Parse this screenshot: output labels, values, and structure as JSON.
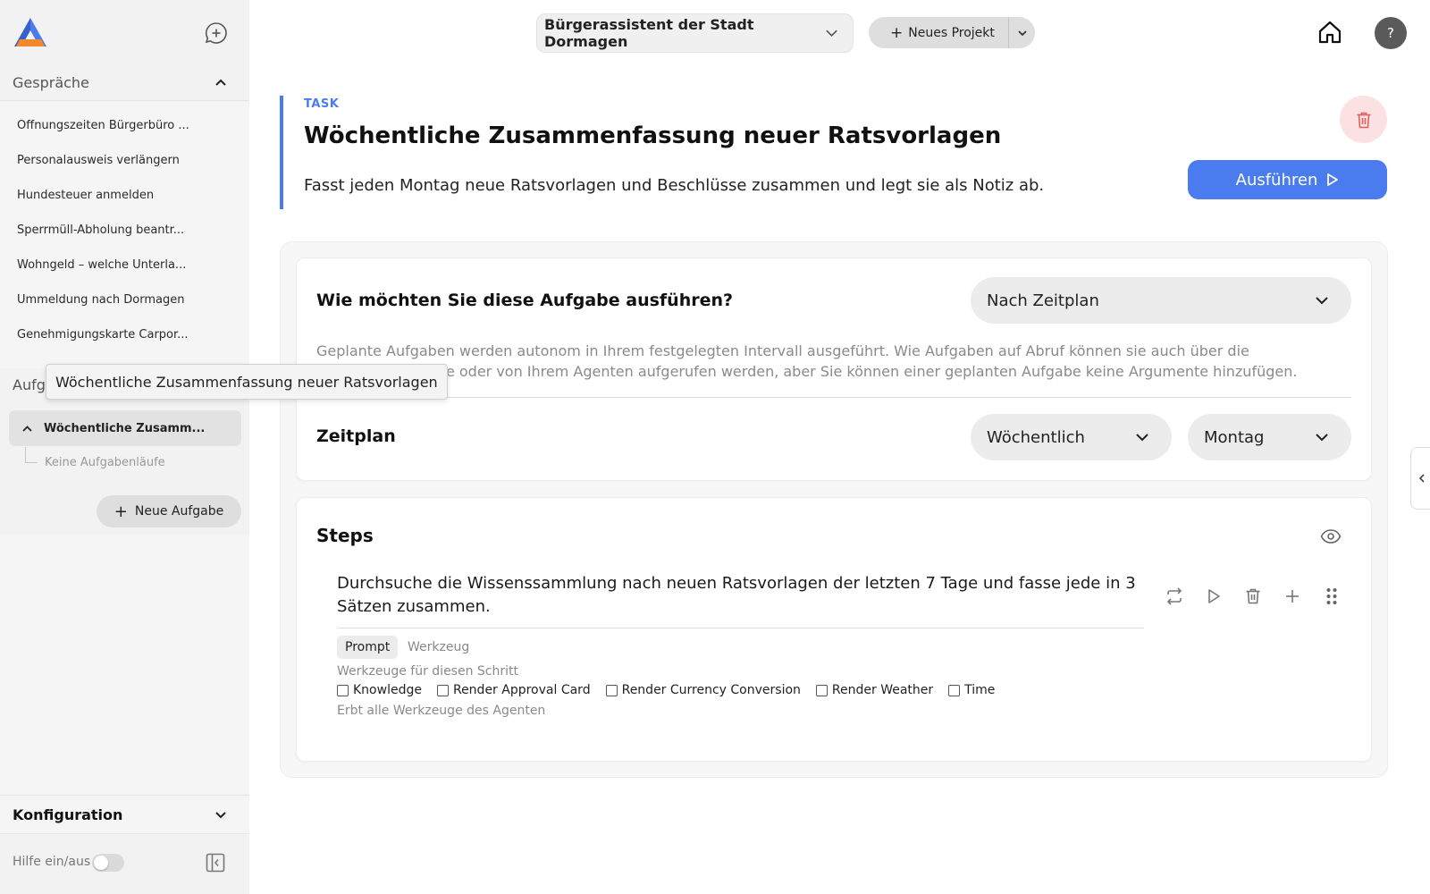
{
  "sidebar": {
    "conversations_label": "Gespräche",
    "conversations": [
      "Öffnungszeiten Bürgerbüro ...",
      "Personalausweis verlängern",
      "Hundesteuer anmelden",
      "Sperrmüll-Abholung beantr...",
      "Wohngeld – welche Unterla...",
      "Ummeldung nach Dormagen",
      "Genehmigungskarte Carpor..."
    ],
    "tasks_label": "Aufg",
    "tooltip": "Wöchentliche Zusammenfassung neuer Ratsvorlagen",
    "active_task": "Wöchentliche Zusamm...",
    "task_runs_empty": "Keine Aufgabenläufe",
    "new_task_label": "Neue Aufgabe",
    "config_label": "Konfiguration",
    "help_toggle_label": "Hilfe ein/aus"
  },
  "topbar": {
    "project": "Bürgerassistent der Stadt Dormagen",
    "new_project_label": "Neues Projekt",
    "help_label": "?"
  },
  "task": {
    "tag": "TASK",
    "title": "Wöchentliche Zusammenfassung neuer Ratsvorlagen",
    "description": "Fasst jeden Montag neue Ratsvorlagen und Beschlüsse zusammen und legt sie als Notiz ab.",
    "run_label": "Ausführen"
  },
  "execution": {
    "question": "Wie möchten Sie diese Aufgabe ausführen?",
    "mode": "Nach Zeitplan",
    "help_line1": "Geplante Aufgaben werden autonom in Ihrem festgelegten Intervall ausgeführt. Wie Aufgaben auf Abruf können sie auch über die",
    "help_line2": "che oder von Ihrem Agenten aufgerufen werden, aber Sie können einer geplanten Aufgabe keine Argumente hinzufügen.",
    "schedule_label": "Zeitplan",
    "frequency": "Wöchentlich",
    "day": "Montag"
  },
  "steps": {
    "label": "Steps",
    "step_text": "Durchsuche die Wissenssammlung nach neuen Ratsvorlagen der letzten 7 Tage und fasse jede in 3 Sätzen zusammen.",
    "tab_prompt": "Prompt",
    "tab_tool": "Werkzeug",
    "tools_caption": "Werkzeuge für diesen Schritt",
    "tools": [
      "Knowledge",
      "Render Approval Card",
      "Render Currency Conversion",
      "Render Weather",
      "Time"
    ],
    "inherit_caption": "Erbt alle Werkzeuge des Agenten"
  },
  "colors": {
    "accent": "#4a7cf0",
    "danger_bg": "#fbe1e1",
    "danger": "#e06060",
    "sidebar_bg": "#f2f2f2"
  }
}
